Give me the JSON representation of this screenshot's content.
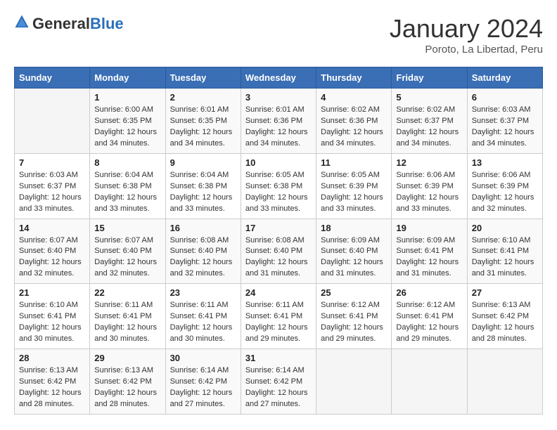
{
  "logo": {
    "text_general": "General",
    "text_blue": "Blue"
  },
  "title": "January 2024",
  "subtitle": "Poroto, La Libertad, Peru",
  "days_header": [
    "Sunday",
    "Monday",
    "Tuesday",
    "Wednesday",
    "Thursday",
    "Friday",
    "Saturday"
  ],
  "weeks": [
    [
      {
        "num": "",
        "info": ""
      },
      {
        "num": "1",
        "info": "Sunrise: 6:00 AM\nSunset: 6:35 PM\nDaylight: 12 hours\nand 34 minutes."
      },
      {
        "num": "2",
        "info": "Sunrise: 6:01 AM\nSunset: 6:35 PM\nDaylight: 12 hours\nand 34 minutes."
      },
      {
        "num": "3",
        "info": "Sunrise: 6:01 AM\nSunset: 6:36 PM\nDaylight: 12 hours\nand 34 minutes."
      },
      {
        "num": "4",
        "info": "Sunrise: 6:02 AM\nSunset: 6:36 PM\nDaylight: 12 hours\nand 34 minutes."
      },
      {
        "num": "5",
        "info": "Sunrise: 6:02 AM\nSunset: 6:37 PM\nDaylight: 12 hours\nand 34 minutes."
      },
      {
        "num": "6",
        "info": "Sunrise: 6:03 AM\nSunset: 6:37 PM\nDaylight: 12 hours\nand 34 minutes."
      }
    ],
    [
      {
        "num": "7",
        "info": "Sunrise: 6:03 AM\nSunset: 6:37 PM\nDaylight: 12 hours\nand 33 minutes."
      },
      {
        "num": "8",
        "info": "Sunrise: 6:04 AM\nSunset: 6:38 PM\nDaylight: 12 hours\nand 33 minutes."
      },
      {
        "num": "9",
        "info": "Sunrise: 6:04 AM\nSunset: 6:38 PM\nDaylight: 12 hours\nand 33 minutes."
      },
      {
        "num": "10",
        "info": "Sunrise: 6:05 AM\nSunset: 6:38 PM\nDaylight: 12 hours\nand 33 minutes."
      },
      {
        "num": "11",
        "info": "Sunrise: 6:05 AM\nSunset: 6:39 PM\nDaylight: 12 hours\nand 33 minutes."
      },
      {
        "num": "12",
        "info": "Sunrise: 6:06 AM\nSunset: 6:39 PM\nDaylight: 12 hours\nand 33 minutes."
      },
      {
        "num": "13",
        "info": "Sunrise: 6:06 AM\nSunset: 6:39 PM\nDaylight: 12 hours\nand 32 minutes."
      }
    ],
    [
      {
        "num": "14",
        "info": "Sunrise: 6:07 AM\nSunset: 6:40 PM\nDaylight: 12 hours\nand 32 minutes."
      },
      {
        "num": "15",
        "info": "Sunrise: 6:07 AM\nSunset: 6:40 PM\nDaylight: 12 hours\nand 32 minutes."
      },
      {
        "num": "16",
        "info": "Sunrise: 6:08 AM\nSunset: 6:40 PM\nDaylight: 12 hours\nand 32 minutes."
      },
      {
        "num": "17",
        "info": "Sunrise: 6:08 AM\nSunset: 6:40 PM\nDaylight: 12 hours\nand 31 minutes."
      },
      {
        "num": "18",
        "info": "Sunrise: 6:09 AM\nSunset: 6:40 PM\nDaylight: 12 hours\nand 31 minutes."
      },
      {
        "num": "19",
        "info": "Sunrise: 6:09 AM\nSunset: 6:41 PM\nDaylight: 12 hours\nand 31 minutes."
      },
      {
        "num": "20",
        "info": "Sunrise: 6:10 AM\nSunset: 6:41 PM\nDaylight: 12 hours\nand 31 minutes."
      }
    ],
    [
      {
        "num": "21",
        "info": "Sunrise: 6:10 AM\nSunset: 6:41 PM\nDaylight: 12 hours\nand 30 minutes."
      },
      {
        "num": "22",
        "info": "Sunrise: 6:11 AM\nSunset: 6:41 PM\nDaylight: 12 hours\nand 30 minutes."
      },
      {
        "num": "23",
        "info": "Sunrise: 6:11 AM\nSunset: 6:41 PM\nDaylight: 12 hours\nand 30 minutes."
      },
      {
        "num": "24",
        "info": "Sunrise: 6:11 AM\nSunset: 6:41 PM\nDaylight: 12 hours\nand 29 minutes."
      },
      {
        "num": "25",
        "info": "Sunrise: 6:12 AM\nSunset: 6:41 PM\nDaylight: 12 hours\nand 29 minutes."
      },
      {
        "num": "26",
        "info": "Sunrise: 6:12 AM\nSunset: 6:41 PM\nDaylight: 12 hours\nand 29 minutes."
      },
      {
        "num": "27",
        "info": "Sunrise: 6:13 AM\nSunset: 6:42 PM\nDaylight: 12 hours\nand 28 minutes."
      }
    ],
    [
      {
        "num": "28",
        "info": "Sunrise: 6:13 AM\nSunset: 6:42 PM\nDaylight: 12 hours\nand 28 minutes."
      },
      {
        "num": "29",
        "info": "Sunrise: 6:13 AM\nSunset: 6:42 PM\nDaylight: 12 hours\nand 28 minutes."
      },
      {
        "num": "30",
        "info": "Sunrise: 6:14 AM\nSunset: 6:42 PM\nDaylight: 12 hours\nand 27 minutes."
      },
      {
        "num": "31",
        "info": "Sunrise: 6:14 AM\nSunset: 6:42 PM\nDaylight: 12 hours\nand 27 minutes."
      },
      {
        "num": "",
        "info": ""
      },
      {
        "num": "",
        "info": ""
      },
      {
        "num": "",
        "info": ""
      }
    ]
  ]
}
